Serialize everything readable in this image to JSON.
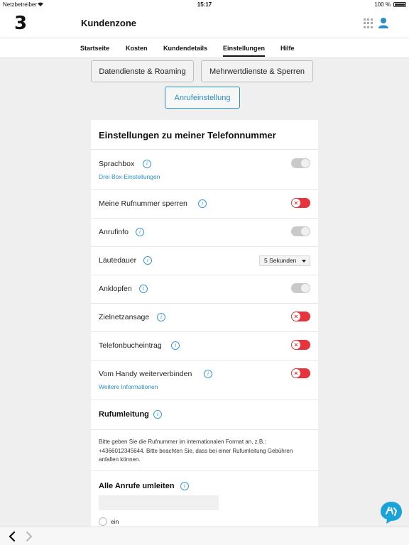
{
  "statusbar": {
    "carrier": "Netzbetreiber",
    "time": "15:17",
    "battery": "100 %"
  },
  "header": {
    "logo_text": "3",
    "title": "Kundenzone"
  },
  "nav": {
    "tabs": [
      "Startseite",
      "Kosten",
      "Kundendetails",
      "Einstellungen",
      "Hilfe"
    ],
    "active": "Einstellungen"
  },
  "buttons": {
    "data_roaming": "Datendienste & Roaming",
    "value_added": "Mehrwertdienste & Sperren",
    "call_settings": "Anrufeinstellung"
  },
  "card": {
    "title": "Einstellungen zu meiner Telefonnummer",
    "rows": [
      {
        "label": "Sprachbox",
        "link": "Drei Box-Einstellungen",
        "toggle": "off"
      },
      {
        "label": "Meine Rufnummer sperren",
        "toggle": "on-red"
      },
      {
        "label": "Anrufinfo",
        "toggle": "off"
      },
      {
        "label": "Läutedauer",
        "select_value": "5 Sekunden"
      },
      {
        "label": "Anklopfen",
        "toggle": "off"
      },
      {
        "label": "Zielnetzansage",
        "toggle": "on-red"
      },
      {
        "label": "Telefonbucheintrag",
        "toggle": "on-red"
      },
      {
        "label": "Vom Handy weiterverbinden",
        "link": "Weitere Informationen",
        "toggle": "on-red"
      }
    ],
    "forwarding": {
      "title": "Rufumleitung",
      "description": "Bitte geben Sie die Rufnummer im internationalen Format an, z.B.: +4366012345644. Bitte beachten Sie, dass bei einer Rufumleitung Gebühren anfallen können.",
      "all_calls_title": "Alle Anrufe umleiten",
      "input_value": "",
      "radio_label": "ein"
    }
  },
  "toggle_glyph": "×",
  "info_glyph": "i",
  "colors": {
    "accent": "#2a8dc8",
    "toggle_on": "#e8323c",
    "fab": "#1aa3d9"
  }
}
